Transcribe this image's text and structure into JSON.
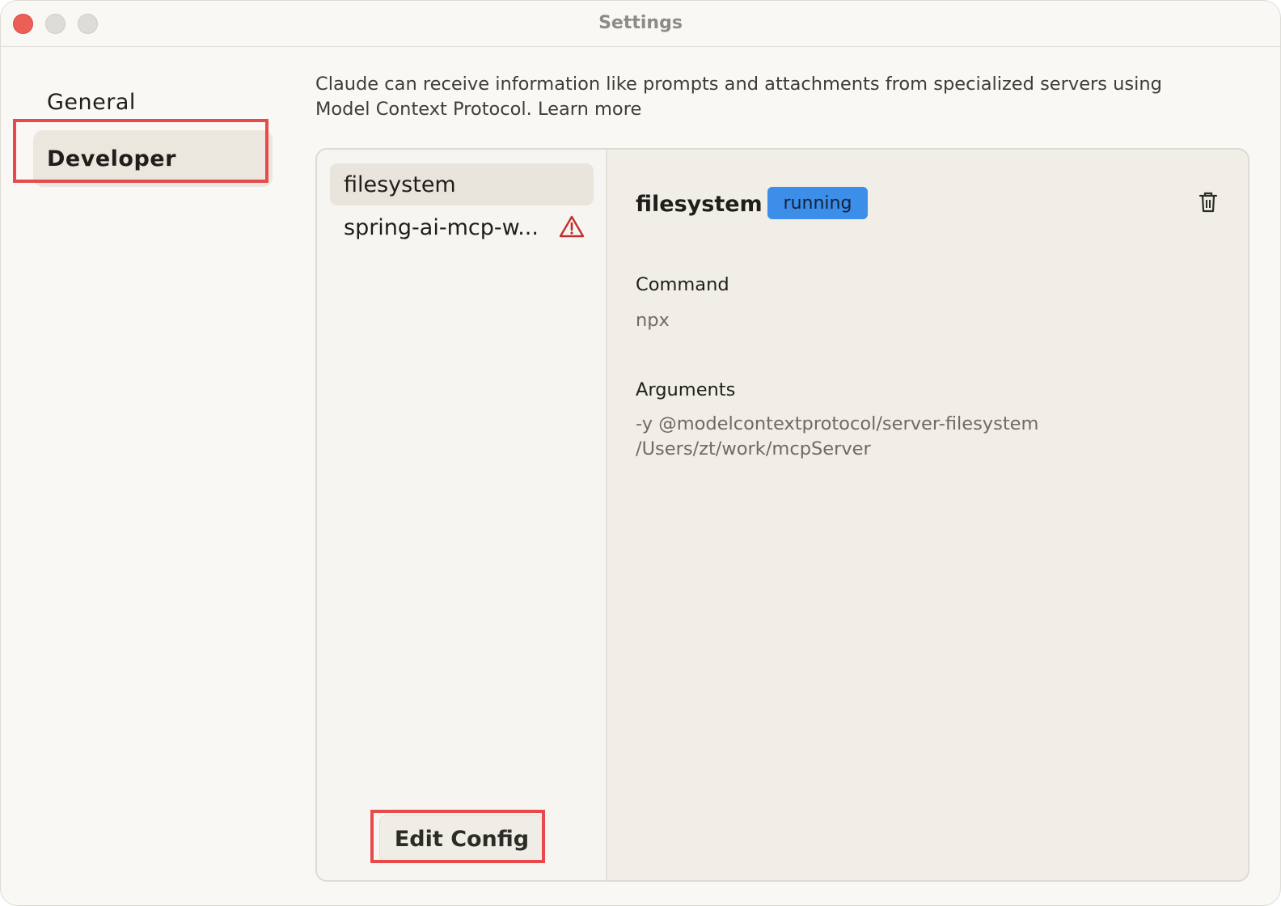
{
  "window": {
    "title": "Settings"
  },
  "nav": {
    "general": "General",
    "developer": "Developer"
  },
  "intro": {
    "text": "Claude can receive information like prompts and attachments from specialized servers using Model Context Protocol. Learn more"
  },
  "servers": [
    {
      "name": "filesystem",
      "selected": true,
      "warning": false
    },
    {
      "name": "spring-ai-mcp-w...",
      "selected": false,
      "warning": true
    }
  ],
  "edit_config_label": "Edit Config",
  "detail": {
    "name": "filesystem",
    "status": "running",
    "command_label": "Command",
    "command": "npx",
    "arguments_label": "Arguments",
    "arguments_line1": "-y @modelcontextprotocol/server-filesystem",
    "arguments_line2": "/Users/zt/work/mcpServer"
  },
  "colors": {
    "status_running": "#3d8ee8",
    "highlight": "#e8494a",
    "warning": "#c0302a"
  },
  "icons": {
    "warning": "warning-triangle-icon",
    "delete": "trash-icon"
  }
}
